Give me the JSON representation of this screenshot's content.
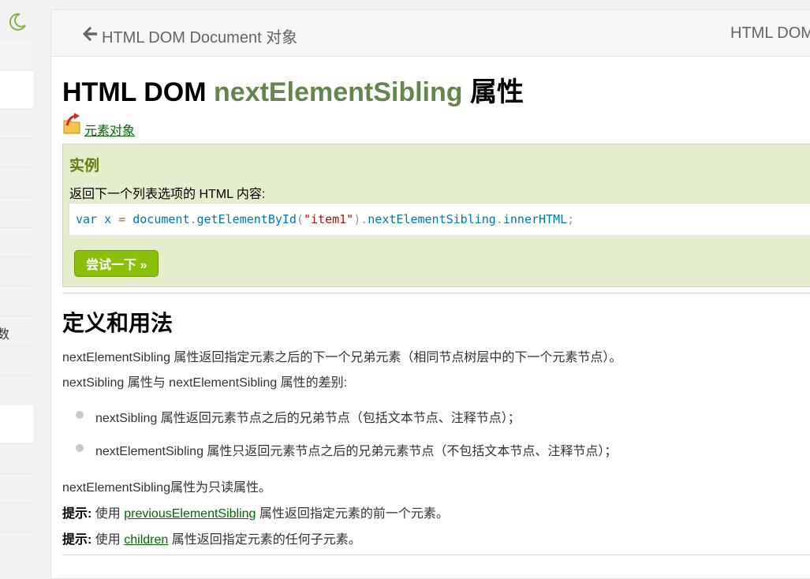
{
  "nav": {
    "prev_label": "HTML DOM Document 对象",
    "next_label": "HTML DOM"
  },
  "sidebar": {
    "partial_char": "数"
  },
  "page": {
    "title_prefix": "HTML DOM ",
    "title_highlight": "nextElementSibling",
    "title_suffix": " 属性",
    "back_link": "元素对象"
  },
  "example": {
    "heading": "实例",
    "description": "返回下一个列表选项的 HTML 内容:",
    "code": {
      "kw": "var",
      "var": "x",
      "eq": "=",
      "obj": "document",
      "method": "getElementById",
      "open": "(",
      "str": "\"item1\"",
      "close": ")",
      "prop1": "nextElementSibling",
      "prop2": "innerHTML",
      "dot": ".",
      "semi": ";"
    },
    "try_button": "尝试一下 »"
  },
  "definition": {
    "heading": "定义和用法",
    "p1": "nextElementSibling 属性返回指定元素之后的下一个兄弟元素（相同节点树层中的下一个元素节点）。",
    "p2": "nextSibling 属性与 nextElementSibling 属性的差别:",
    "bullets": [
      "nextSibling 属性返回元素节点之后的兄弟节点（包括文本节点、注释节点）；",
      "nextElementSibling 属性只返回元素节点之后的兄弟元素节点（不包括文本节点、注释节点）；"
    ],
    "p3": "nextElementSibling属性为只读属性。",
    "tip_label": "提示:",
    "tip1_before": " 使用 ",
    "tip1_link": "previousElementSibling",
    "tip1_after": " 属性返回指定元素的前一个元素。",
    "tip2_before": " 使用 ",
    "tip2_link": "children",
    "tip2_after": " 属性返回指定元素的任何子元素。"
  },
  "colors": {
    "accent_green": "#617f10",
    "button_green": "#8ac007",
    "example_bg": "#e5eecc",
    "link_green": "#006600"
  }
}
